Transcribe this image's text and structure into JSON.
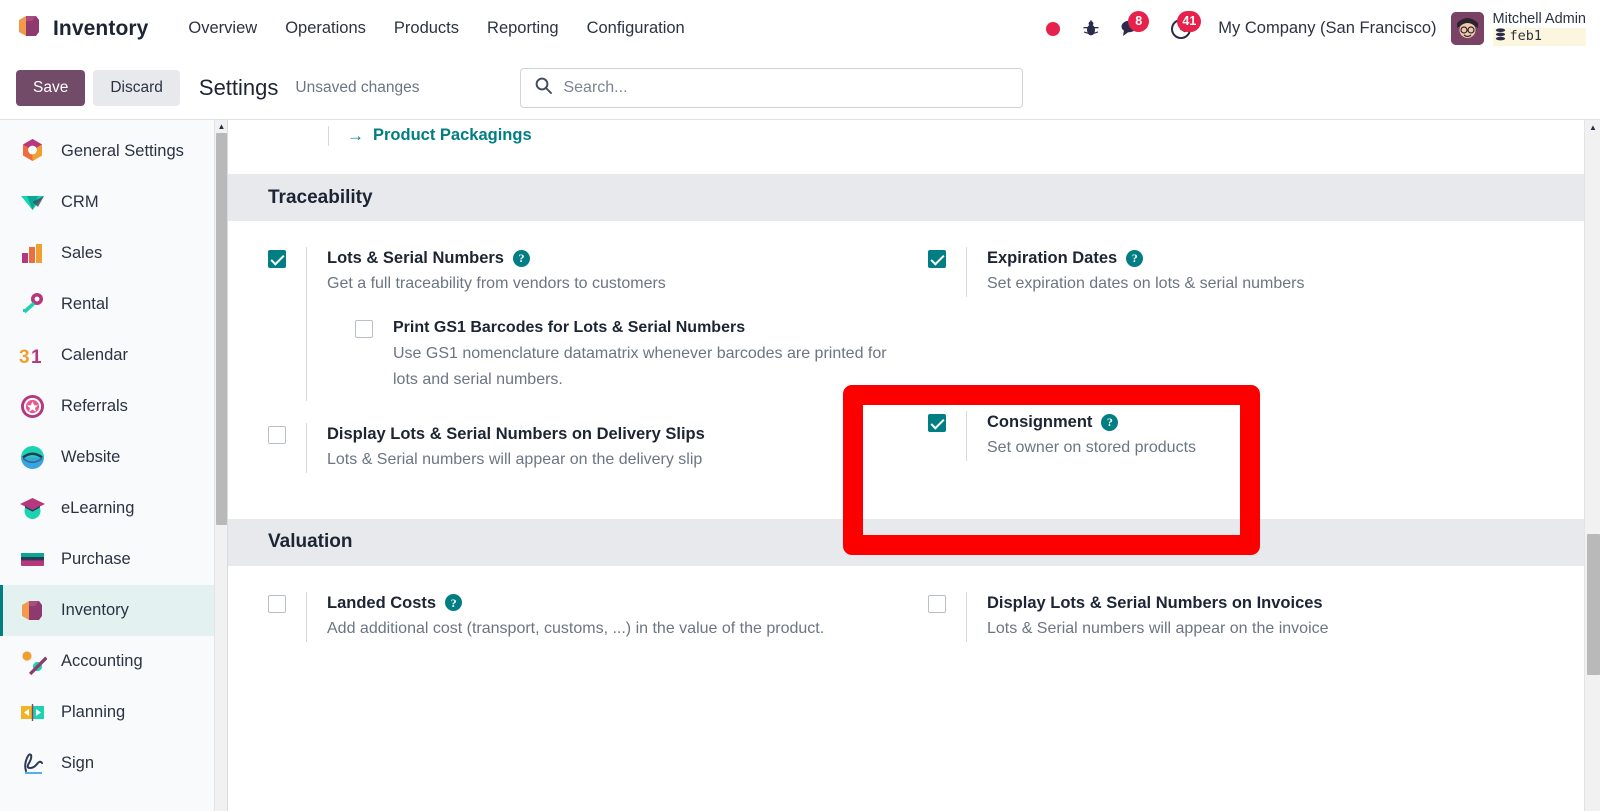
{
  "navbar": {
    "brand": "Inventory",
    "brand_icon": "inventory-box-icon",
    "menu": [
      "Overview",
      "Operations",
      "Products",
      "Reporting",
      "Configuration"
    ],
    "status_dot_icon": "record-dot-icon",
    "debug_icon": "bug-icon",
    "messages_icon": "messages-icon",
    "messages_count": "8",
    "activities_icon": "clock-activities-icon",
    "activities_count": "41",
    "company": "My Company (San Francisco)",
    "user_name": "Mitchell Admin",
    "user_db": "feb1",
    "db_icon": "database-icon",
    "avatar_icon": "user-avatar"
  },
  "controlbar": {
    "save_label": "Save",
    "discard_label": "Discard",
    "title": "Settings",
    "unsaved": "Unsaved changes",
    "search_placeholder": "Search...",
    "search_value": "",
    "search_icon": "search-icon"
  },
  "sidebar": {
    "items": [
      {
        "label": "General Settings",
        "icon": "settings-gear-icon",
        "active": false
      },
      {
        "label": "CRM",
        "icon": "crm-icon",
        "active": false
      },
      {
        "label": "Sales",
        "icon": "sales-bars-icon",
        "active": false
      },
      {
        "label": "Rental",
        "icon": "rental-key-icon",
        "active": false
      },
      {
        "label": "Calendar",
        "icon": "calendar-31-icon",
        "active": false
      },
      {
        "label": "Referrals",
        "icon": "referrals-badge-icon",
        "active": false
      },
      {
        "label": "Website",
        "icon": "website-icon",
        "active": false
      },
      {
        "label": "eLearning",
        "icon": "elearning-cap-icon",
        "active": false
      },
      {
        "label": "Purchase",
        "icon": "purchase-card-icon",
        "active": false
      },
      {
        "label": "Inventory",
        "icon": "inventory-box-icon",
        "active": true
      },
      {
        "label": "Accounting",
        "icon": "accounting-percent-icon",
        "active": false
      },
      {
        "label": "Planning",
        "icon": "planning-icon",
        "active": false
      },
      {
        "label": "Sign",
        "icon": "sign-signature-icon",
        "active": false
      }
    ]
  },
  "content": {
    "top_link": {
      "label": "Product Packagings",
      "icon": "arrow-right-icon"
    },
    "sections": [
      {
        "heading": "Traceability",
        "left": [
          {
            "title": "Lots & Serial Numbers",
            "desc": "Get a full traceability from vendors to customers",
            "checked": true,
            "help": true,
            "children": [
              {
                "title": "Print GS1 Barcodes for Lots & Serial Numbers",
                "desc": "Use GS1 nomenclature datamatrix whenever barcodes are printed for lots and serial numbers.",
                "checked": false,
                "help": false
              }
            ]
          },
          {
            "title": "Display Lots & Serial Numbers on Delivery Slips",
            "desc": "Lots & Serial numbers will appear on the delivery slip",
            "checked": false,
            "help": false
          }
        ],
        "right": [
          {
            "title": "Expiration Dates",
            "desc": "Set expiration dates on lots & serial numbers",
            "checked": true,
            "help": true
          },
          {
            "title": "Consignment",
            "desc": "Set owner on stored products",
            "checked": true,
            "help": true,
            "highlighted": true
          }
        ]
      },
      {
        "heading": "Valuation",
        "left": [
          {
            "title": "Landed Costs",
            "desc": "Add additional cost (transport, customs, ...) in the value of the product.",
            "checked": false,
            "help": true
          }
        ],
        "right": [
          {
            "title": "Display Lots & Serial Numbers on Invoices",
            "desc": "Lots & Serial numbers will appear on the invoice",
            "checked": false,
            "help": false
          }
        ]
      }
    ]
  },
  "colors": {
    "accent_teal": "#017e84",
    "brand_purple": "#714b67",
    "badge_red": "#e6214b",
    "highlight_red": "#fc0000",
    "section_bg": "#e7e9ed"
  }
}
